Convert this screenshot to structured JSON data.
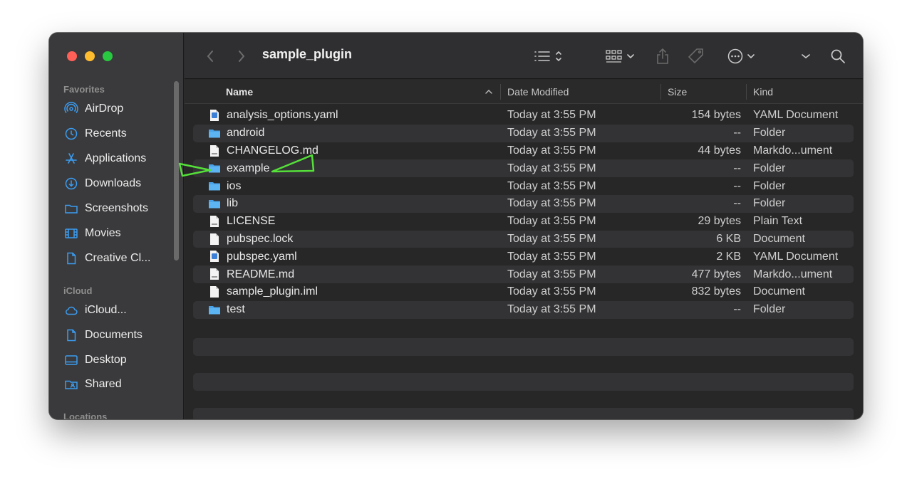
{
  "window": {
    "title": "sample_plugin"
  },
  "sidebar": {
    "favorites_label": "Favorites",
    "favorites": [
      {
        "label": "AirDrop",
        "icon": "airdrop-icon"
      },
      {
        "label": "Recents",
        "icon": "clock-icon"
      },
      {
        "label": "Applications",
        "icon": "applications-icon"
      },
      {
        "label": "Downloads",
        "icon": "download-icon"
      },
      {
        "label": "Screenshots",
        "icon": "folder-icon"
      },
      {
        "label": "Movies",
        "icon": "film-icon"
      },
      {
        "label": "Creative Cl...",
        "icon": "document-icon"
      }
    ],
    "icloud_label": "iCloud",
    "icloud": [
      {
        "label": "iCloud...",
        "icon": "cloud-icon"
      },
      {
        "label": "Documents",
        "icon": "document-icon"
      },
      {
        "label": "Desktop",
        "icon": "desktop-icon"
      },
      {
        "label": "Shared",
        "icon": "shared-folder-icon"
      }
    ],
    "locations_label": "Locations"
  },
  "columns": {
    "name": "Name",
    "date": "Date Modified",
    "size": "Size",
    "kind": "Kind"
  },
  "files": [
    {
      "name": "analysis_options.yaml",
      "date": "Today at 3:55 PM",
      "size": "154 bytes",
      "kind": "YAML Document",
      "icon": "yaml-file-icon"
    },
    {
      "name": "android",
      "date": "Today at 3:55 PM",
      "size": "--",
      "kind": "Folder",
      "icon": "folder-icon"
    },
    {
      "name": "CHANGELOG.md",
      "date": "Today at 3:55 PM",
      "size": "44 bytes",
      "kind": "Markdo...ument",
      "icon": "markdown-file-icon"
    },
    {
      "name": "example",
      "date": "Today at 3:55 PM",
      "size": "--",
      "kind": "Folder",
      "icon": "folder-icon"
    },
    {
      "name": "ios",
      "date": "Today at 3:55 PM",
      "size": "--",
      "kind": "Folder",
      "icon": "folder-icon"
    },
    {
      "name": "lib",
      "date": "Today at 3:55 PM",
      "size": "--",
      "kind": "Folder",
      "icon": "folder-icon"
    },
    {
      "name": "LICENSE",
      "date": "Today at 3:55 PM",
      "size": "29 bytes",
      "kind": "Plain Text",
      "icon": "text-file-icon"
    },
    {
      "name": "pubspec.lock",
      "date": "Today at 3:55 PM",
      "size": "6 KB",
      "kind": "Document",
      "icon": "document-file-icon"
    },
    {
      "name": "pubspec.yaml",
      "date": "Today at 3:55 PM",
      "size": "2 KB",
      "kind": "YAML Document",
      "icon": "yaml-file-icon"
    },
    {
      "name": "README.md",
      "date": "Today at 3:55 PM",
      "size": "477 bytes",
      "kind": "Markdo...ument",
      "icon": "markdown-file-icon"
    },
    {
      "name": "sample_plugin.iml",
      "date": "Today at 3:55 PM",
      "size": "832 bytes",
      "kind": "Document",
      "icon": "document-file-icon"
    },
    {
      "name": "test",
      "date": "Today at 3:55 PM",
      "size": "--",
      "kind": "Folder",
      "icon": "folder-icon"
    }
  ],
  "colors": {
    "folder": "#4aa3e8",
    "annotation": "#55e03a",
    "accent": "#0a84ff"
  }
}
